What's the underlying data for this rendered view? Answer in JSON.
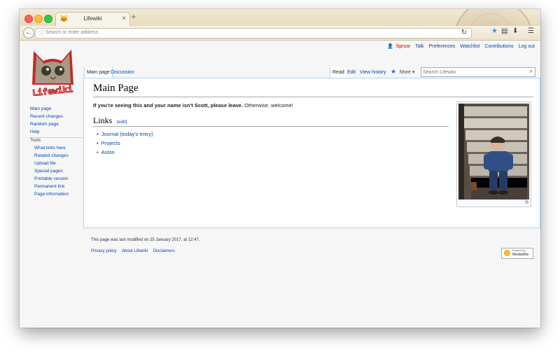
{
  "browser": {
    "tab_title": "Lifewiki",
    "new_tab": "+",
    "tab_close": "×",
    "url_placeholder": "Search or enter address"
  },
  "personal": {
    "items": [
      "Sprusr",
      "Talk",
      "Preferences",
      "Watchlist",
      "Contributions",
      "Log out"
    ]
  },
  "logo": {
    "text": "Lifewiki"
  },
  "sidebar": {
    "nav": [
      "Main page",
      "Recent changes",
      "Random page",
      "Help"
    ],
    "tools_heading": "Tools",
    "tools": [
      "What links here",
      "Related changes",
      "Upload file",
      "Special pages",
      "Printable version",
      "Permanent link",
      "Page information"
    ]
  },
  "page_tabs": {
    "main": "Main page",
    "discussion": "Discussion"
  },
  "view_tabs": {
    "read": "Read",
    "edit": "Edit",
    "history": "View history",
    "more": "More"
  },
  "search": {
    "placeholder": "Search Lifewiki"
  },
  "content": {
    "title": "Main Page",
    "intro_bold": "If you're seeing this and your name isn't Scott, please leave.",
    "intro_rest": " Otherwise, welcome!",
    "links_heading": "Links",
    "edit_link": "[edit]",
    "links": [
      "Journal (today's entry)",
      "Projects",
      "Aston"
    ]
  },
  "footer": {
    "modified": "This page was last modified on 25 January 2017, at 12:47.",
    "links": [
      "Privacy policy",
      "About Lifewiki",
      "Disclaimers"
    ],
    "badge_top": "Powered by",
    "badge_bottom": "MediaWiki"
  },
  "colors": {
    "link": "#0645ad",
    "border": "#a7d7f9"
  },
  "icons": [
    "back-arrow-icon",
    "info-icon",
    "reload-icon",
    "bookmark-star-icon",
    "clipboard-icon",
    "download-icon",
    "menu-icon",
    "user-icon",
    "watch-star-icon",
    "search-icon",
    "magnify-icon"
  ]
}
